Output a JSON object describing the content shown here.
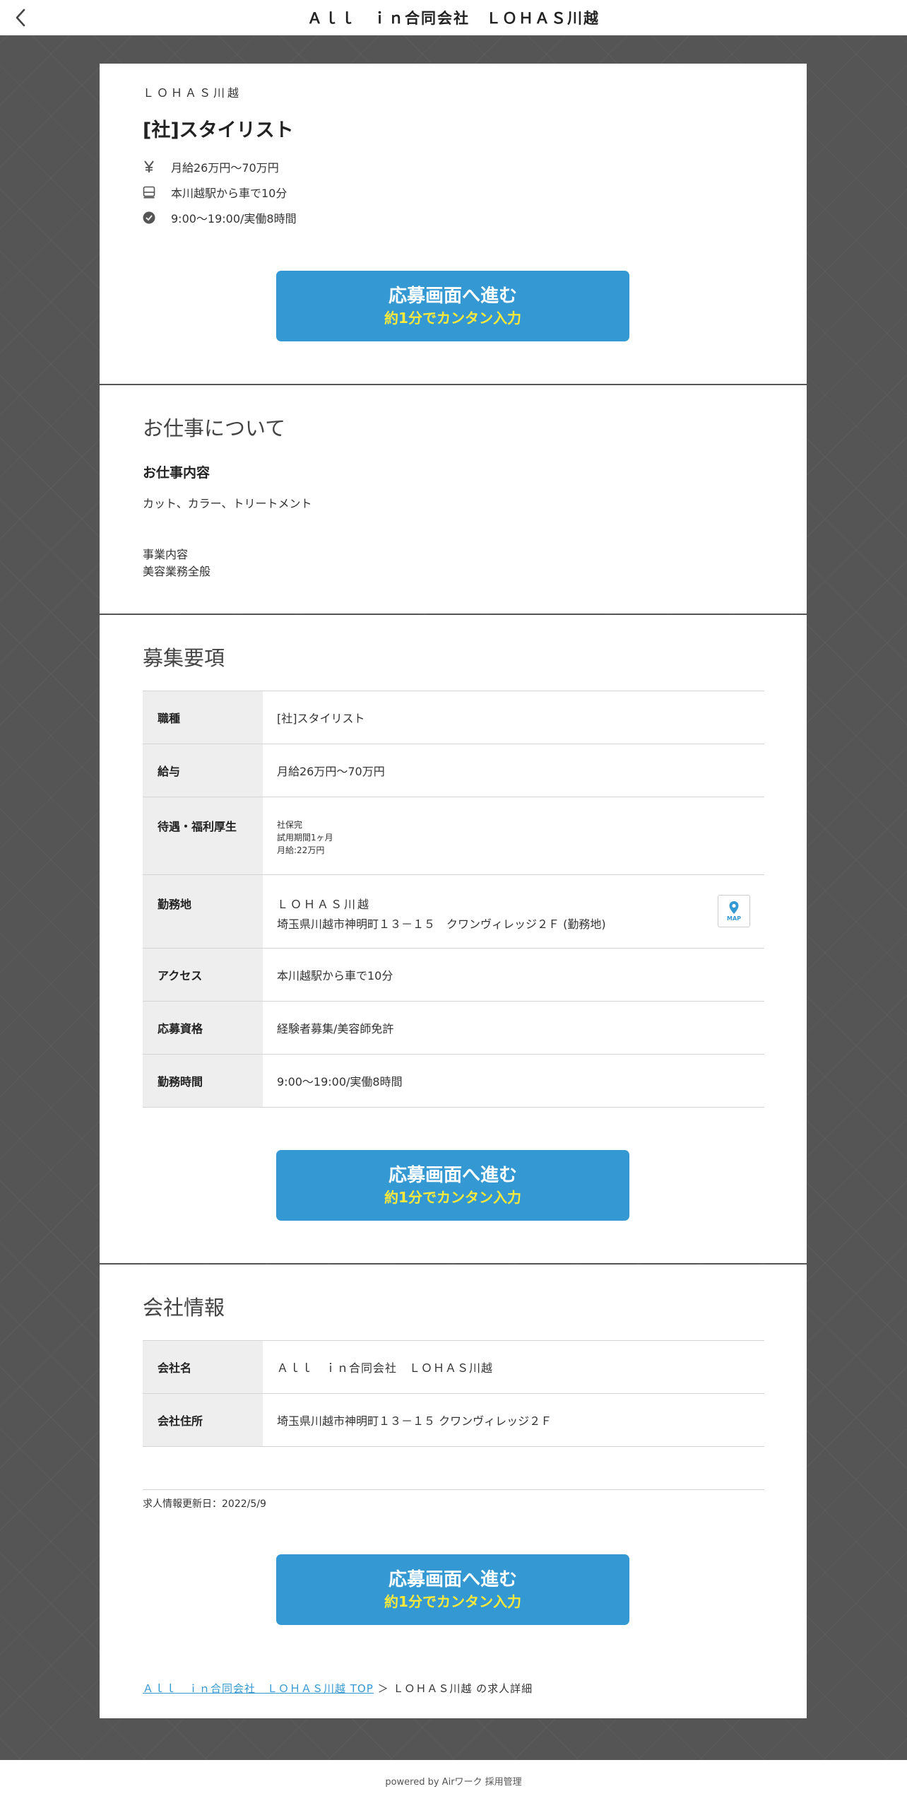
{
  "header": {
    "title": "Ａｌｌ　ｉｎ合同会社　ＬＯＨＡＳ川越",
    "back_icon": "chevron-left-icon"
  },
  "job": {
    "store_name": "ＬＯＨＡＳ川越",
    "title": "[社]スタイリスト",
    "salary": "月給26万円〜70万円",
    "access": "本川越駅から車で10分",
    "hours": "9:00〜19:00/実働8時間",
    "icons": [
      "yen-icon",
      "train-icon",
      "clock-icon"
    ]
  },
  "cta": {
    "main": "応募画面へ進む",
    "sub": "約1分でカンタン入力",
    "color": "#3498d3",
    "sub_color": "#ffe93b"
  },
  "work": {
    "section_title": "お仕事について",
    "content_title": "お仕事内容",
    "content": "カット、カラー、トリートメント",
    "business_label": "事業内容",
    "business_value": "美容業務全般"
  },
  "requirements": {
    "section_title": "募集要項",
    "rows": [
      {
        "label": "職種",
        "value": "[社]スタイリスト"
      },
      {
        "label": "給与",
        "value": "月給26万円〜70万円"
      },
      {
        "label": "待遇・福利厚生",
        "lines": [
          "社保完",
          "試用期間1ヶ月",
          "月給:22万円"
        ]
      },
      {
        "label": "勤務地",
        "line1": "ＬＯＨＡＳ川越",
        "line2": "埼玉県川越市神明町１３－１５　クワンヴィレッジ２Ｆ (勤務地)",
        "map_label": "MAP"
      },
      {
        "label": "アクセス",
        "value": "本川越駅から車で10分"
      },
      {
        "label": "応募資格",
        "value": "経験者募集/美容師免許"
      },
      {
        "label": "勤務時間",
        "value": "9:00〜19:00/実働8時間"
      }
    ]
  },
  "company": {
    "section_title": "会社情報",
    "rows": [
      {
        "label": "会社名",
        "value": "Ａｌｌ　ｉｎ合同会社　ＬＯＨＡＳ川越"
      },
      {
        "label": "会社住所",
        "value": "埼玉県川越市神明町１３－１５ クワンヴィレッジ２Ｆ"
      }
    ],
    "updated": "求人情報更新日：2022/5/9"
  },
  "breadcrumb": {
    "top_link": "Ａｌｌ　ｉｎ合同会社　ＬＯＨＡＳ川越 TOP",
    "separator": "＞",
    "current": "ＬＯＨＡＳ川越 の求人詳細"
  },
  "footer": {
    "text": "powered by Airワーク 採用管理"
  }
}
